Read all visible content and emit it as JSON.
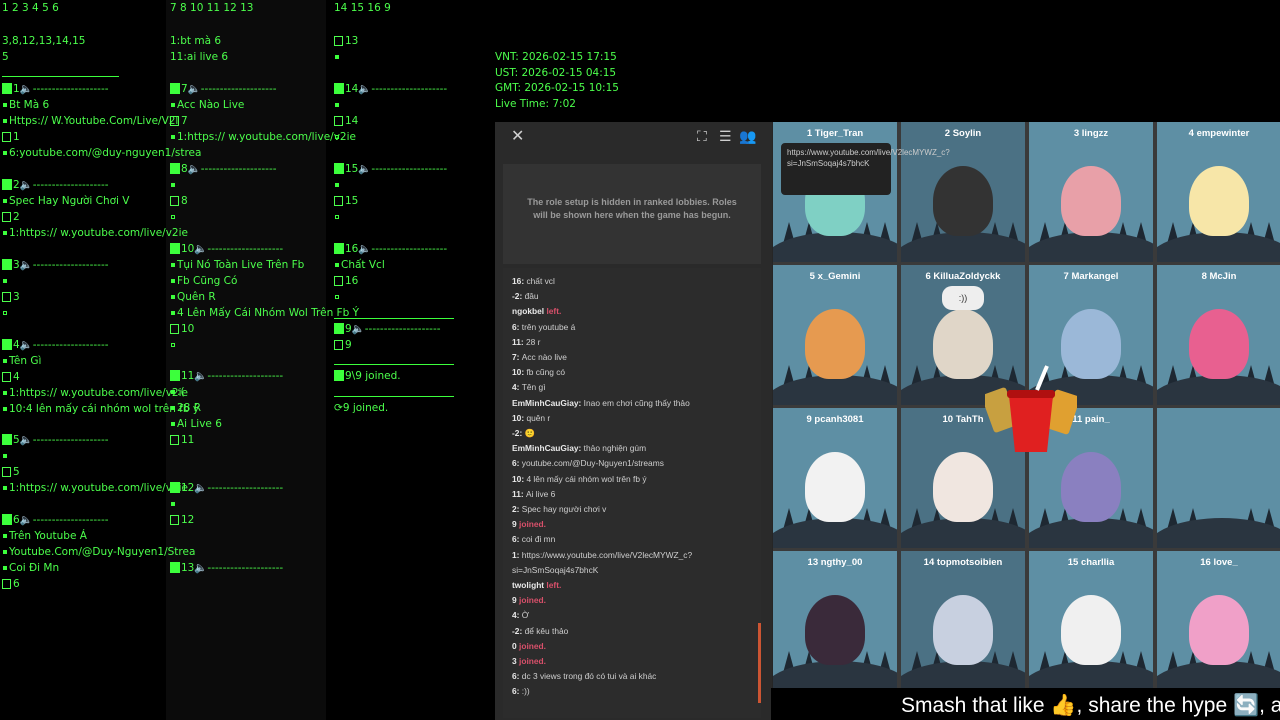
{
  "col1": {
    "header": "1 2 3 4 5 6",
    "info1": "3,8,12,13,14,15",
    "info2": "5",
    "slots": [
      {
        "num": "1",
        "dash": "--------------------",
        "lines": [
          "Bt Mà 6",
          "Https:// W.Youtube.Com/Live/V2l",
          "1",
          "6:youtube.com/@duy-nguyen1/strea"
        ]
      },
      {
        "num": "2",
        "dash": "--------------------",
        "lines": [
          "Spec Hay Người Chơi V",
          "2",
          "1:https:// w.youtube.com/live/v2ie"
        ]
      },
      {
        "num": "3",
        "dash": "--------------------",
        "lines": [
          "",
          "3",
          ""
        ]
      },
      {
        "num": "4",
        "dash": "--------------------",
        "lines": [
          "Tên Gì",
          "4",
          "1:https:// w.youtube.com/live/v2ie",
          "10:4 lên mấy cái nhóm wol trên fb ý"
        ]
      },
      {
        "num": "5",
        "dash": "--------------------",
        "lines": [
          "",
          "5",
          "1:https:// w.youtube.com/live/v2ie"
        ]
      },
      {
        "num": "6",
        "dash": "--------------------",
        "lines": [
          "Trên Youtube Á",
          "Youtube.Com/@Duy-Nguyen1/Strea",
          "Coi Đi Mn",
          "6"
        ]
      }
    ]
  },
  "col2": {
    "header": "7 8 10 11 12 13",
    "info1": "1:bt mà 6",
    "info2": "11:ai live 6",
    "slots": [
      {
        "num": "7",
        "dash": "--------------------",
        "lines": [
          "Acc Nào Live",
          "7",
          "1:https:// w.youtube.com/live/v2ie"
        ]
      },
      {
        "num": "8",
        "dash": "--------------------",
        "lines": [
          "",
          "8",
          ""
        ]
      },
      {
        "num": "10",
        "dash": "--------------------",
        "lines": [
          "Tụi Nó Toàn Live Trên Fb",
          "Fb Cũng Có",
          "Quên R",
          "4 Lên Mấy Cái Nhóm Wol Trên Fb Ý",
          "10",
          ""
        ]
      },
      {
        "num": "11",
        "dash": "--------------------",
        "lines": [
          ":(",
          "28 R",
          "Ai Live 6",
          "11"
        ]
      },
      {
        "num": "12",
        "dash": "--------------------",
        "lines": [
          "",
          "12"
        ]
      },
      {
        "num": "13",
        "dash": "--------------------",
        "lines": []
      }
    ]
  },
  "col3": {
    "header": "14 15 16 9",
    "line13": "13",
    "slots": [
      {
        "num": "14",
        "dash": "--------------------",
        "lines": [
          "",
          "14",
          ""
        ]
      },
      {
        "num": "15",
        "dash": "--------------------",
        "lines": [
          "",
          "15",
          ""
        ]
      },
      {
        "num": "16",
        "dash": "--------------------",
        "lines": [
          "Chất Vcl",
          "16",
          ""
        ]
      },
      {
        "num": "9",
        "dash": "--------------------",
        "lines": [
          "9"
        ]
      }
    ],
    "joined1": "9\\9 joined.",
    "joined2": "9 joined."
  },
  "times": {
    "vnt": "VNT: 2026-02-15 17:15",
    "ust": "UST: 2026-02-15 04:15",
    "gmt": "GMT: 2026-02-15 10:15",
    "live": "Live Time: 7:02"
  },
  "roles_text": "The role setup is hidden in ranked lobbies. Roles will be shown here when the game has begun.",
  "chat": [
    {
      "who": "16:",
      "msg": "chất vcl"
    },
    {
      "who": "-2:",
      "msg": "đâu"
    },
    {
      "who": "ngokbel",
      "msg": "left.",
      "red": true
    },
    {
      "who": "6:",
      "msg": "trên youtube á"
    },
    {
      "who": "11:",
      "msg": "28 r"
    },
    {
      "who": "7:",
      "msg": "Acc nào live"
    },
    {
      "who": "10:",
      "msg": "fb cũng có"
    },
    {
      "who": "4:",
      "msg": "Tên gì"
    },
    {
      "who": "EmMinhCauGiay:",
      "msg": "Inao em chơi cũng thấy thảo"
    },
    {
      "who": "10:",
      "msg": "quên r"
    },
    {
      "who": "-2:",
      "msg": "🙂"
    },
    {
      "who": "EmMinhCauGiay:",
      "msg": "thảo nghiện gúm"
    },
    {
      "who": "6:",
      "msg": "youtube.com/@Duy-Nguyen1/streams"
    },
    {
      "who": "10:",
      "msg": "4 lên mấy cái nhóm wol trên fb ý"
    },
    {
      "who": "11:",
      "msg": "Ai live 6"
    },
    {
      "who": "2:",
      "msg": "Spec hay người chơi v"
    },
    {
      "who": "9",
      "msg": "joined.",
      "red": true
    },
    {
      "who": "6:",
      "msg": "coi đi mn"
    },
    {
      "who": "1:",
      "msg": "https://www.youtube.com/live/V2lecMYWZ_c?"
    },
    {
      "who": "",
      "msg": "si=JnSmSoqaj4s7bhcK"
    },
    {
      "who": "twolight",
      "msg": "left.",
      "red": true
    },
    {
      "who": "9",
      "msg": "joined.",
      "red": true
    },
    {
      "who": "4:",
      "msg": "Ờ"
    },
    {
      "who": "-2:",
      "msg": "để kêu thảo"
    },
    {
      "who": "0",
      "msg": "joined.",
      "red": true
    },
    {
      "who": "3",
      "msg": "joined.",
      "red": true
    },
    {
      "who": "6:",
      "msg": "dc 3 views trong đó có tui và ai khác"
    },
    {
      "who": "6:",
      "msg": ":))"
    }
  ],
  "players": [
    {
      "name": "1 Tiger_Tran",
      "color": "#7fd0c4"
    },
    {
      "name": "2 Soylin",
      "color": "#333"
    },
    {
      "name": "3 lingzz",
      "color": "#e8a0a8"
    },
    {
      "name": "4 empewinter",
      "color": "#f7e6a8"
    },
    {
      "name": "5 x_Gemini",
      "color": "#e69a50"
    },
    {
      "name": "6 KilluaZoldyckk",
      "color": "#e0d6c8"
    },
    {
      "name": "7 Markangel",
      "color": "#9bb8d8"
    },
    {
      "name": "8 McJin",
      "color": "#e86090"
    },
    {
      "name": "9 pcanh3081",
      "color": "#f2f2f2"
    },
    {
      "name": "10 TahTh",
      "color": "#f0e6e0"
    },
    {
      "name": "11 pain_",
      "color": "#8a80c0"
    },
    {
      "name": "",
      "color": ""
    },
    {
      "name": "13 ngthy_00",
      "color": "#3a2a3a"
    },
    {
      "name": "14 topmotsoibien",
      "color": "#c8d0e0"
    },
    {
      "name": "15 charllia",
      "color": "#f0f0f0"
    },
    {
      "name": "16 love_",
      "color": "#f0a0c8"
    }
  ],
  "tooltip": "https://www.youtube.com/live/V2lecMYWZ_c?si=JnSmSoqaj4s7bhcK",
  "bubble": ":))",
  "ticker": "Smash that like 👍, share the hype 🔄, and fo"
}
